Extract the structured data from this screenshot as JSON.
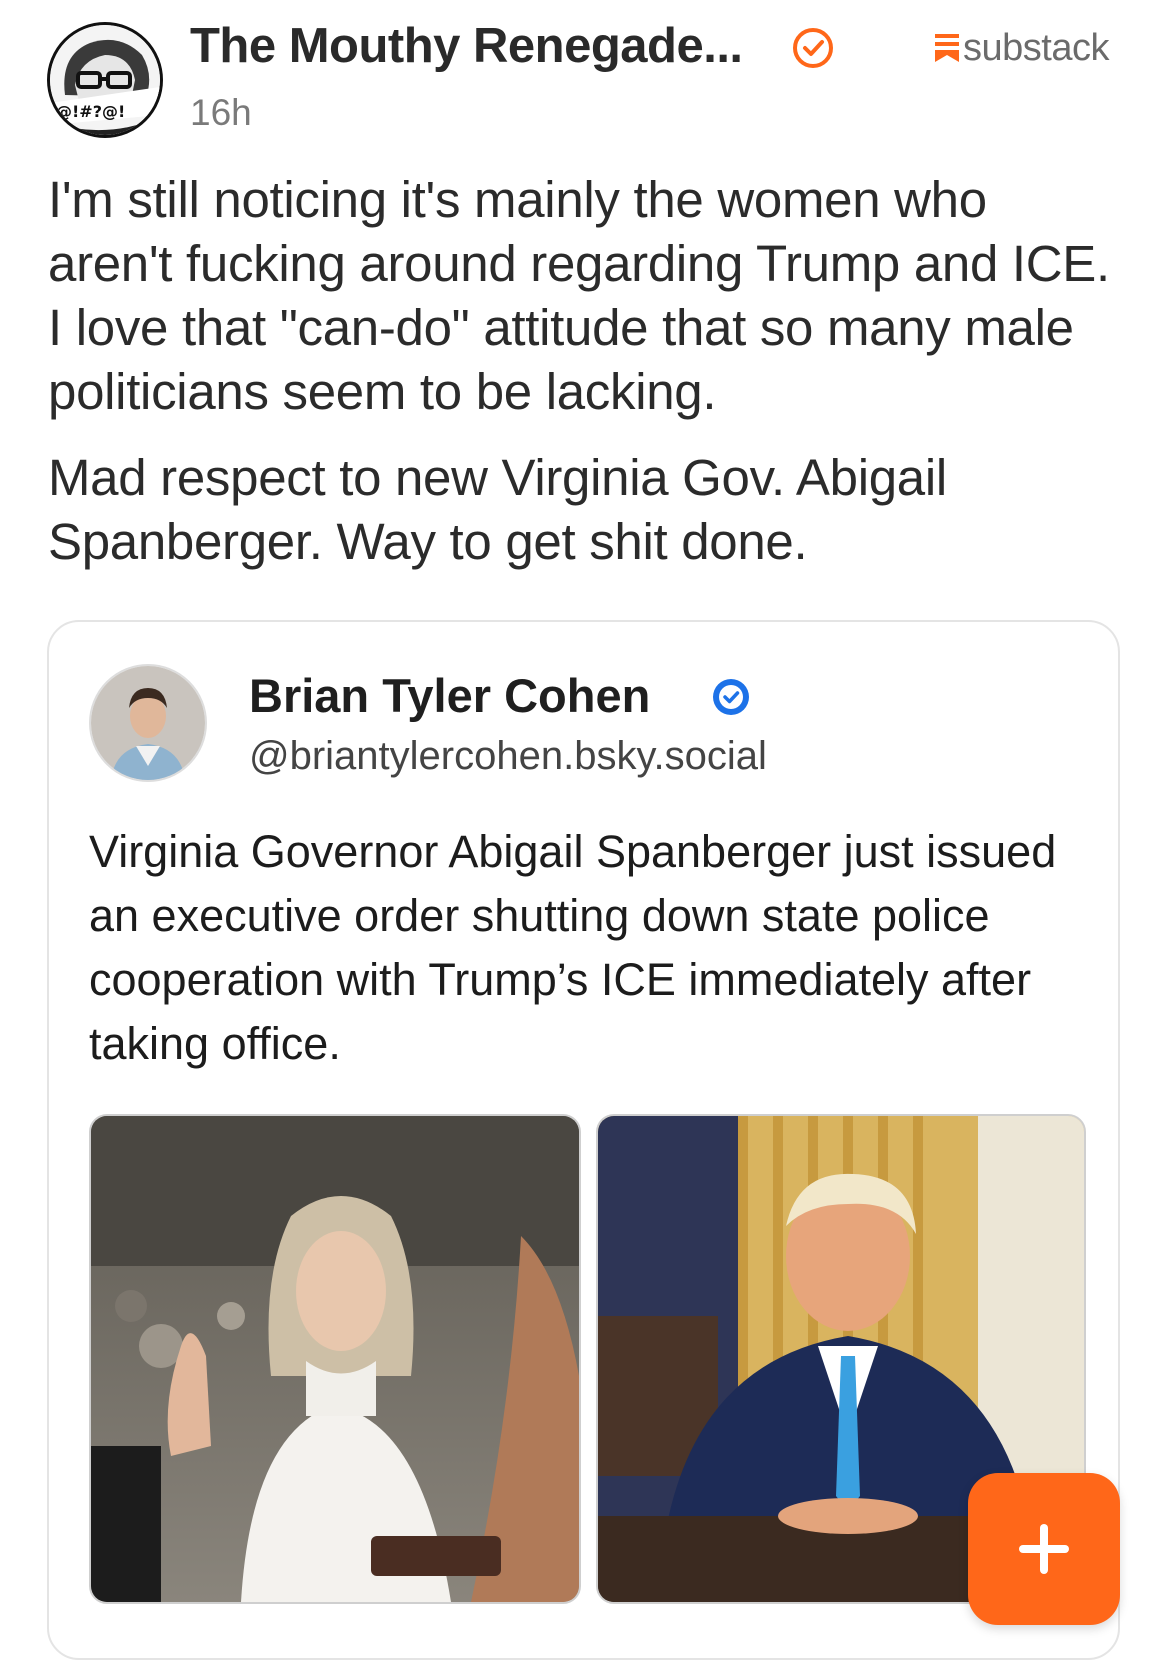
{
  "post": {
    "author": "The Mouthy Renegade...",
    "time": "16h",
    "source_brand": "substack",
    "paragraphs": [
      "I'm still noticing it's mainly the women who aren't fucking around regarding Trump and ICE. I love that \"can-do\" attitude that so many male politicians seem to be lacking.",
      "Mad respect to new Virginia Gov. Abigail Spanberger. Way to get shit done."
    ]
  },
  "embed": {
    "name": "Brian Tyler Cohen",
    "handle": "@briantylercohen.bsky.social",
    "text": "Virginia Governor Abigail Spanberger just issued an executive order shutting down state police cooperation with Trump’s ICE immediately after taking office."
  },
  "fab": {
    "label": "+"
  },
  "colors": {
    "accent": "#ff6719",
    "verified_blue": "#1d72e8",
    "verified_orange": "#ff6719"
  },
  "icons": [
    "verified-badge-icon",
    "substack-logo-icon",
    "plus-icon"
  ]
}
